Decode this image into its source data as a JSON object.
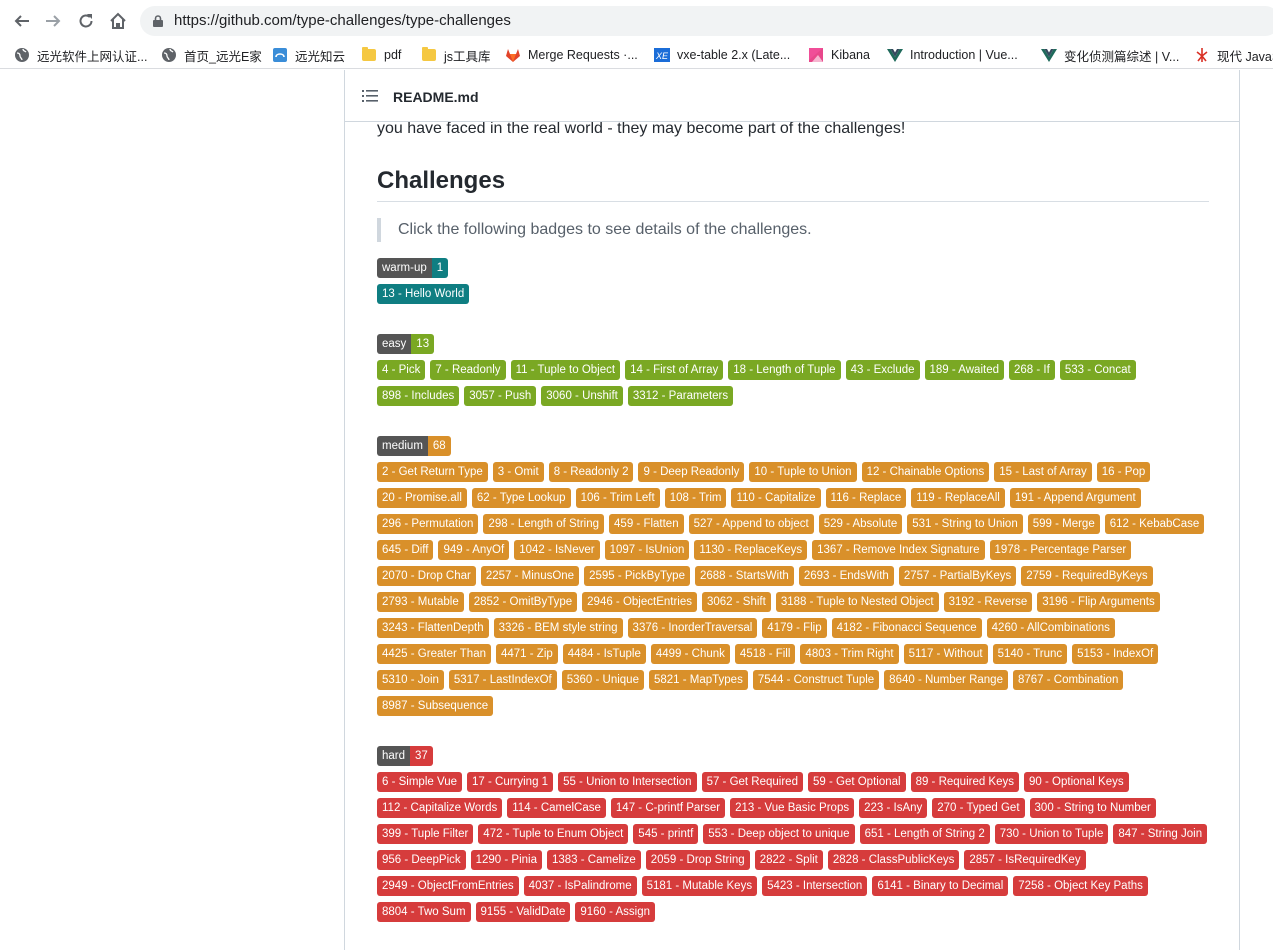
{
  "browser": {
    "url": "https://github.com/type-challenges/type-challenges",
    "bookmarks": [
      {
        "label": "远光软件上网认证...",
        "icon": "globe-icon"
      },
      {
        "label": "首页_远光E家",
        "icon": "globe-icon"
      },
      {
        "label": "远光知云",
        "icon": "cloud-icon"
      },
      {
        "label": "pdf",
        "icon": "folder-icon"
      },
      {
        "label": "js工具库",
        "icon": "folder-icon"
      },
      {
        "label": "Merge Requests ·...",
        "icon": "gitlab-icon"
      },
      {
        "label": "vxe-table 2.x (Late...",
        "icon": "vxe-icon"
      },
      {
        "label": "Kibana",
        "icon": "kibana-icon"
      },
      {
        "label": "Introduction | Vue...",
        "icon": "vue-icon"
      },
      {
        "label": "变化侦测篇综述 | V...",
        "icon": "vue-icon"
      },
      {
        "label": "现代 JavaS",
        "icon": "js-icon"
      }
    ]
  },
  "readme": {
    "title": "README.md",
    "intro_tail": "you have faced in the real world - they may become part of the challenges!",
    "heading": "Challenges",
    "quote": "Click the following badges to see details of the challenges."
  },
  "groups": {
    "warm": {
      "label": "warm-up",
      "count": "1",
      "items": [
        "13 - Hello World"
      ]
    },
    "easy": {
      "label": "easy",
      "count": "13",
      "items": [
        "4 - Pick",
        "7 - Readonly",
        "11 - Tuple to Object",
        "14 - First of Array",
        "18 - Length of Tuple",
        "43 - Exclude",
        "189 - Awaited",
        "268 - If",
        "533 - Concat",
        "898 - Includes",
        "3057 - Push",
        "3060 - Unshift",
        "3312 - Parameters"
      ]
    },
    "medium": {
      "label": "medium",
      "count": "68",
      "items": [
        "2 - Get Return Type",
        "3 - Omit",
        "8 - Readonly 2",
        "9 - Deep Readonly",
        "10 - Tuple to Union",
        "12 - Chainable Options",
        "15 - Last of Array",
        "16 - Pop",
        "20 - Promise.all",
        "62 - Type Lookup",
        "106 - Trim Left",
        "108 - Trim",
        "110 - Capitalize",
        "116 - Replace",
        "119 - ReplaceAll",
        "191 - Append Argument",
        "296 - Permutation",
        "298 - Length of String",
        "459 - Flatten",
        "527 - Append to object",
        "529 - Absolute",
        "531 - String to Union",
        "599 - Merge",
        "612 - KebabCase",
        "645 - Diff",
        "949 - AnyOf",
        "1042 - IsNever",
        "1097 - IsUnion",
        "1130 - ReplaceKeys",
        "1367 - Remove Index Signature",
        "1978 - Percentage Parser",
        "2070 - Drop Char",
        "2257 - MinusOne",
        "2595 - PickByType",
        "2688 - StartsWith",
        "2693 - EndsWith",
        "2757 - PartialByKeys",
        "2759 - RequiredByKeys",
        "2793 - Mutable",
        "2852 - OmitByType",
        "2946 - ObjectEntries",
        "3062 - Shift",
        "3188 - Tuple to Nested Object",
        "3192 - Reverse",
        "3196 - Flip Arguments",
        "3243 - FlattenDepth",
        "3326 - BEM style string",
        "3376 - InorderTraversal",
        "4179 - Flip",
        "4182 - Fibonacci Sequence",
        "4260 - AllCombinations",
        "4425 - Greater Than",
        "4471 - Zip",
        "4484 - IsTuple",
        "4499 - Chunk",
        "4518 - Fill",
        "4803 - Trim Right",
        "5117 - Without",
        "5140 - Trunc",
        "5153 - IndexOf",
        "5310 - Join",
        "5317 - LastIndexOf",
        "5360 - Unique",
        "5821 - MapTypes",
        "7544 - Construct Tuple",
        "8640 - Number Range",
        "8767 - Combination",
        "8987 - Subsequence"
      ]
    },
    "hard": {
      "label": "hard",
      "count": "37",
      "items": [
        "6 - Simple Vue",
        "17 - Currying 1",
        "55 - Union to Intersection",
        "57 - Get Required",
        "59 - Get Optional",
        "89 - Required Keys",
        "90 - Optional Keys",
        "112 - Capitalize Words",
        "114 - CamelCase",
        "147 - C-printf Parser",
        "213 - Vue Basic Props",
        "223 - IsAny",
        "270 - Typed Get",
        "300 - String to Number",
        "399 - Tuple Filter",
        "472 - Tuple to Enum Object",
        "545 - printf",
        "553 - Deep object to unique",
        "651 - Length of String 2",
        "730 - Union to Tuple",
        "847 - String Join",
        "956 - DeepPick",
        "1290 - Pinia",
        "1383 - Camelize",
        "2059 - Drop String",
        "2822 - Split",
        "2828 - ClassPublicKeys",
        "2857 - IsRequiredKey",
        "2949 - ObjectFromEntries",
        "4037 - IsPalindrome",
        "5181 - Mutable Keys",
        "5423 - Intersection",
        "6141 - Binary to Decimal",
        "7258 - Object Key Paths",
        "8804 - Two Sum",
        "9155 - ValidDate",
        "9160 - Assign"
      ]
    }
  },
  "colors": {
    "warm": "#0f7e82",
    "easy": "#7aa823",
    "medium": "#d9902a",
    "hard": "#d63c3c",
    "label_bg": "#555555"
  }
}
